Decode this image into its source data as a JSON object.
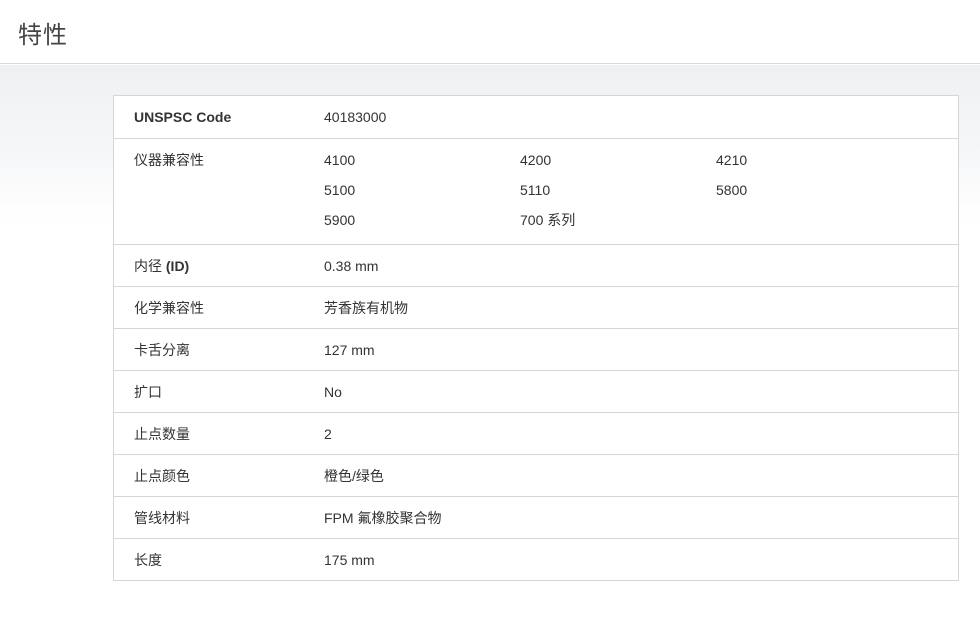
{
  "header": {
    "title": "特性"
  },
  "specs": {
    "unspsc": {
      "label": "UNSPSC Code",
      "value": "40183000"
    },
    "compatibility": {
      "label": "仪器兼容性",
      "values": [
        "4100",
        "4200",
        "4210",
        "5100",
        "5110",
        "5800",
        "5900",
        "700 系列"
      ]
    },
    "inner_diameter": {
      "label_prefix": "内径 ",
      "label_bold": "(ID)",
      "value": "0.38 mm"
    },
    "chemical_compat": {
      "label": "化学兼容性",
      "value": "芳香族有机物"
    },
    "cassette_separation": {
      "label": "卡舌分离",
      "value": "127 mm"
    },
    "flared": {
      "label": "扩口",
      "value": "No"
    },
    "stop_count": {
      "label": "止点数量",
      "value": "2"
    },
    "stop_color": {
      "label": "止点颜色",
      "value": "橙色/绿色"
    },
    "tubing_material": {
      "label": "管线材料",
      "value": "FPM 氟橡胶聚合物"
    },
    "length": {
      "label": "长度",
      "value": "175 mm"
    }
  }
}
